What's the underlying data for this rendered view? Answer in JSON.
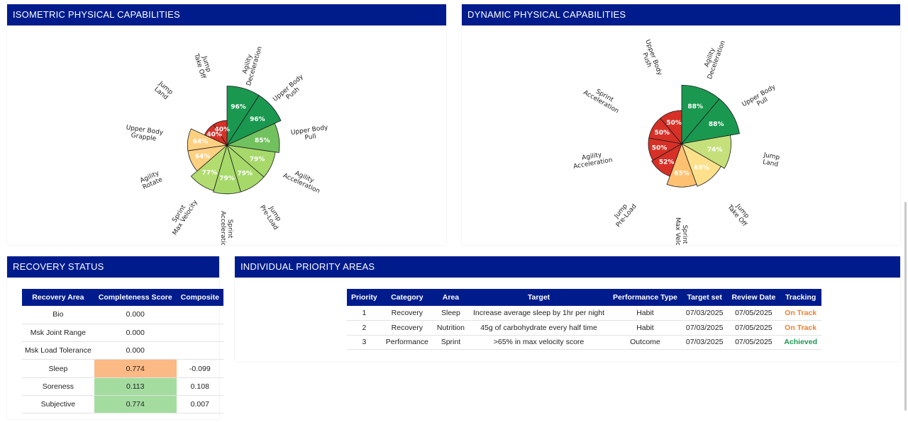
{
  "isometric": {
    "title": "ISOMETRIC PHYSICAL CAPABILITIES",
    "chart_data": {
      "type": "polar-bar",
      "segments": [
        {
          "label": "Agility Deceleration",
          "lines": [
            "Agility",
            "Deceleration"
          ],
          "value": 96,
          "text": "96%",
          "color": "#1a9850"
        },
        {
          "label": "Upper Body Push",
          "lines": [
            "Upper Body",
            "Push"
          ],
          "value": 96,
          "text": "96%",
          "color": "#1a9850"
        },
        {
          "label": "Upper Body Pull",
          "lines": [
            "Upper Body",
            "Pull"
          ],
          "value": 85,
          "text": "85%",
          "color": "#72c15f"
        },
        {
          "label": "Agility Acceleration",
          "lines": [
            "Agility",
            "Acceleration"
          ],
          "value": 79,
          "text": "79%",
          "color": "#a6d96a"
        },
        {
          "label": "Jump Pre-Load",
          "lines": [
            "Jump",
            "Pre-Load"
          ],
          "value": 79,
          "text": "79%",
          "color": "#a6d96a"
        },
        {
          "label": "Sprint Acceleratio",
          "lines": [
            "Sprint",
            "Acceleratio"
          ],
          "value": 79,
          "text": "79%",
          "color": "#a6d96a"
        },
        {
          "label": "Sprint Max Velocity",
          "lines": [
            "Sprint",
            "Max Velocity"
          ],
          "value": 77,
          "text": "77%",
          "color": "#b2dc6f"
        },
        {
          "label": "Agility Rotate",
          "lines": [
            "Agility",
            "Rotate"
          ],
          "value": 64,
          "text": "64%",
          "color": "#fdd081"
        },
        {
          "label": "Upper Body Grapple",
          "lines": [
            "Upper Body",
            "Grapple"
          ],
          "value": 64,
          "text": "64%",
          "color": "#fdd081"
        },
        {
          "label": "Jump Land",
          "lines": [
            "Jump",
            "Land"
          ],
          "value": 40,
          "text": "40%",
          "color": "#d73027"
        },
        {
          "label": "Jump Take Off",
          "lines": [
            "Jump",
            "Take Off"
          ],
          "value": 40,
          "text": "40%",
          "color": "#d73027"
        }
      ]
    }
  },
  "dynamic": {
    "title": "DYNAMIC PHYSICAL CAPABILITIES",
    "chart_data": {
      "type": "polar-bar",
      "segments": [
        {
          "label": "Agility Deceleration",
          "lines": [
            "Agility",
            "Deceleration"
          ],
          "value": 88,
          "text": "88%",
          "color": "#1a9850"
        },
        {
          "label": "Upper Body Pull",
          "lines": [
            "Upper Body",
            "Pull"
          ],
          "value": 88,
          "text": "88%",
          "color": "#1a9850"
        },
        {
          "label": "Jump Land",
          "lines": [
            "Jump",
            "Land"
          ],
          "value": 74,
          "text": "74%",
          "color": "#c5e07a"
        },
        {
          "label": "Jump Take Off",
          "lines": [
            "Jump",
            "Take Off"
          ],
          "value": 68,
          "text": "68%",
          "color": "#fee08b"
        },
        {
          "label": "Sprint Max Velocity",
          "lines": [
            "Sprint",
            "Max Veloci"
          ],
          "value": 65,
          "text": "65%",
          "color": "#fdc171"
        },
        {
          "label": "Jump Pre-Load",
          "lines": [
            "Jump",
            "Pre-Load"
          ],
          "value": 52,
          "text": "52%",
          "color": "#d73027"
        },
        {
          "label": "Agility Acceleration",
          "lines": [
            "Agility",
            "Acceleration"
          ],
          "value": 50,
          "text": "50%",
          "color": "#d73027"
        },
        {
          "label": "Sprint Acceleration",
          "lines": [
            "Sprint",
            "Acceleration"
          ],
          "value": 50,
          "text": "50%",
          "color": "#d73027"
        },
        {
          "label": "Upper Body Push",
          "lines": [
            "Upper Body",
            "Push"
          ],
          "value": 50,
          "text": "50%",
          "color": "#d73027"
        }
      ]
    }
  },
  "recovery": {
    "title": "RECOVERY STATUS",
    "headers": [
      "Recovery Area",
      "Completeness Score",
      "Composite"
    ],
    "rows": [
      {
        "area": "Bio",
        "score": "0.000",
        "composite": "",
        "score_color": ""
      },
      {
        "area": "Msk Joint Range",
        "score": "0.000",
        "composite": "",
        "score_color": ""
      },
      {
        "area": "Msk Load Tolerance",
        "score": "0.000",
        "composite": "",
        "score_color": ""
      },
      {
        "area": "Sleep",
        "score": "0.774",
        "composite": "-0.099",
        "score_color": "#fbb985"
      },
      {
        "area": "Soreness",
        "score": "0.113",
        "composite": "0.108",
        "score_color": "#a4dca0"
      },
      {
        "area": "Subjective",
        "score": "0.774",
        "composite": "0.007",
        "score_color": "#a4dca0"
      }
    ]
  },
  "priority": {
    "title": "INDIVIDUAL PRIORITY AREAS",
    "headers": [
      "Priority",
      "Category",
      "Area",
      "Target",
      "Performance Type",
      "Target set",
      "Review Date",
      "Tracking"
    ],
    "rows": [
      {
        "priority": "1",
        "category": "Recovery",
        "area": "Sleep",
        "target": "Increase average sleep by 1hr per night",
        "type": "Habit",
        "set": "07/03/2025",
        "review": "07/05/2025",
        "tracking": "On Track",
        "tracking_color": "#f07f2c"
      },
      {
        "priority": "2",
        "category": "Recovery",
        "area": "Nutrition",
        "target": "45g of carbohydrate every half time",
        "type": "Habit",
        "set": "07/03/2025",
        "review": "07/05/2025",
        "tracking": "On Track",
        "tracking_color": "#f07f2c"
      },
      {
        "priority": "3",
        "category": "Performance",
        "area": "Sprint",
        "target": ">65% in max velocity score",
        "type": "Outcome",
        "set": "07/03/2025",
        "review": "07/05/2025",
        "tracking": "Achieved",
        "tracking_color": "#1a9850"
      }
    ]
  }
}
